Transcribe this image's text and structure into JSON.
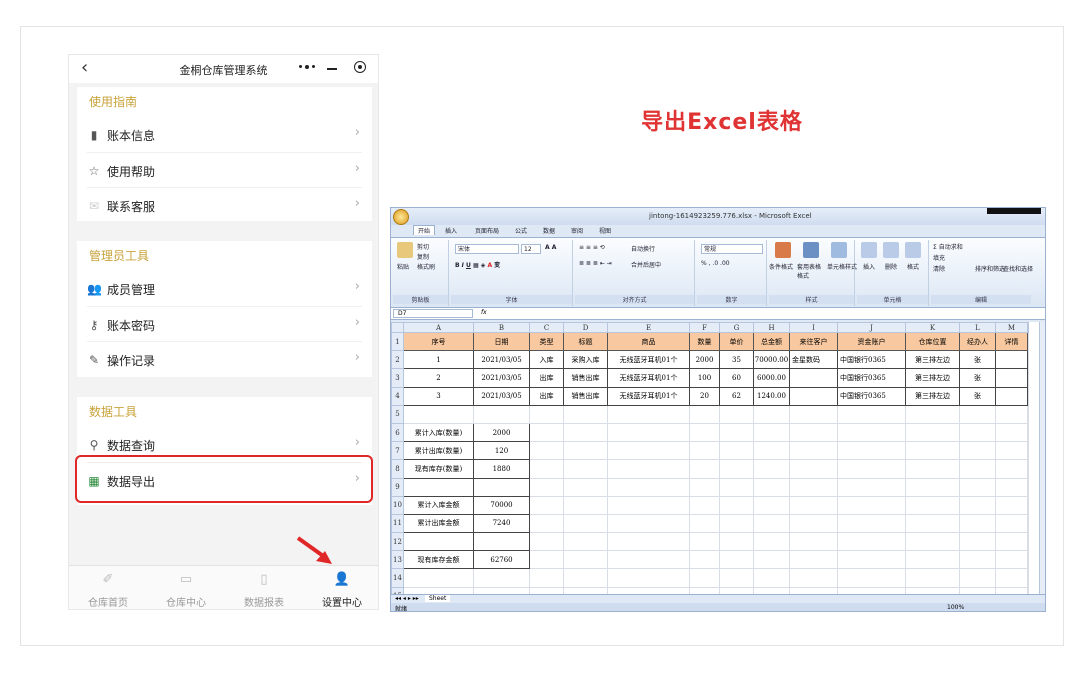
{
  "phone": {
    "title": "金桐仓库管理系统",
    "back_icon": "chevron-left-icon",
    "sections": [
      {
        "title": "使用指南",
        "items": [
          {
            "label": "账本信息",
            "icon": "ledger-icon"
          },
          {
            "label": "使用帮助",
            "icon": "star-icon"
          },
          {
            "label": "联系客服",
            "icon": "mail-icon"
          }
        ]
      },
      {
        "title": "管理员工具",
        "items": [
          {
            "label": "成员管理",
            "icon": "members-icon"
          },
          {
            "label": "账本密码",
            "icon": "key-icon"
          },
          {
            "label": "操作记录",
            "icon": "edit-log-icon"
          }
        ]
      },
      {
        "title": "数据工具",
        "items": [
          {
            "label": "数据查询",
            "icon": "search-icon"
          },
          {
            "label": "数据导出",
            "icon": "excel-icon"
          }
        ]
      }
    ],
    "tabs": [
      {
        "label": "仓库首页",
        "icon": "pen-icon"
      },
      {
        "label": "仓库中心",
        "icon": "warehouse-icon"
      },
      {
        "label": "数据报表",
        "icon": "report-icon"
      },
      {
        "label": "设置中心",
        "icon": "user-icon",
        "active": true
      }
    ]
  },
  "headline": "导出Excel表格",
  "excel": {
    "window_title": "jintong-1614923259.776.xlsx - Microsoft Excel",
    "ribbon_tabs": [
      "开始",
      "插入",
      "页面布局",
      "公式",
      "数据",
      "审阅",
      "视图"
    ],
    "ribbon": {
      "clipboard": {
        "paste": "粘贴",
        "cut": "剪切",
        "copy": "复制",
        "format_painter": "格式刷",
        "group": "剪贴板"
      },
      "font": {
        "name": "宋体",
        "size": "12",
        "group": "字体"
      },
      "alignment": {
        "wrap": "自动换行",
        "merge": "合并后居中",
        "group": "对齐方式"
      },
      "number": {
        "format": "常规",
        "group": "数字"
      },
      "styles": {
        "cond": "条件格式",
        "table": "套用表格格式",
        "cell": "单元格样式",
        "group": "样式"
      },
      "cells": {
        "insert": "插入",
        "delete": "删除",
        "format": "格式",
        "group": "单元格"
      },
      "editing": {
        "autosum": "自动求和",
        "fill": "填充",
        "clear": "清除",
        "sort": "排序和筛选",
        "find": "查找和选择",
        "group": "编辑"
      }
    },
    "name_box": "D7",
    "fx": "fx",
    "col_letters": [
      "A",
      "B",
      "C",
      "D",
      "E",
      "F",
      "G",
      "H",
      "I",
      "J",
      "K",
      "L",
      "M"
    ],
    "headers": [
      "序号",
      "日期",
      "类型",
      "标题",
      "商品",
      "数量",
      "单价",
      "总金额",
      "来往客户",
      "资金账户",
      "仓库位置",
      "经办人",
      "详情"
    ],
    "rows": [
      [
        "1",
        "2021/03/05",
        "入库",
        "采购入库",
        "无线蓝牙耳机01个",
        "2000",
        "35",
        "70000.00",
        "金星数码",
        "中国银行0365",
        "第三排左边",
        "张",
        ""
      ],
      [
        "2",
        "2021/03/05",
        "出库",
        "销售出库",
        "无线蓝牙耳机01个",
        "100",
        "60",
        "6000.00",
        "",
        "中国银行0365",
        "第三排左边",
        "张",
        ""
      ],
      [
        "3",
        "2021/03/05",
        "出库",
        "销售出库",
        "无线蓝牙耳机01个",
        "20",
        "62",
        "1240.00",
        "",
        "中国银行0365",
        "第三排左边",
        "张",
        ""
      ]
    ],
    "summary": [
      {
        "row": "6",
        "label": "累计入库(数量)",
        "value": "2000"
      },
      {
        "row": "7",
        "label": "累计出库(数量)",
        "value": "120"
      },
      {
        "row": "8",
        "label": "现有库存(数量)",
        "value": "1880"
      },
      {
        "row": "9",
        "label": "",
        "value": ""
      },
      {
        "row": "10",
        "label": "累计入库金额",
        "value": "70000"
      },
      {
        "row": "11",
        "label": "累计出库金额",
        "value": "7240"
      },
      {
        "row": "12",
        "label": "",
        "value": ""
      },
      {
        "row": "13",
        "label": "现有库存金额",
        "value": "62760"
      }
    ],
    "sheet_tab": "Sheet",
    "status": "就绪",
    "zoom": "100%"
  }
}
